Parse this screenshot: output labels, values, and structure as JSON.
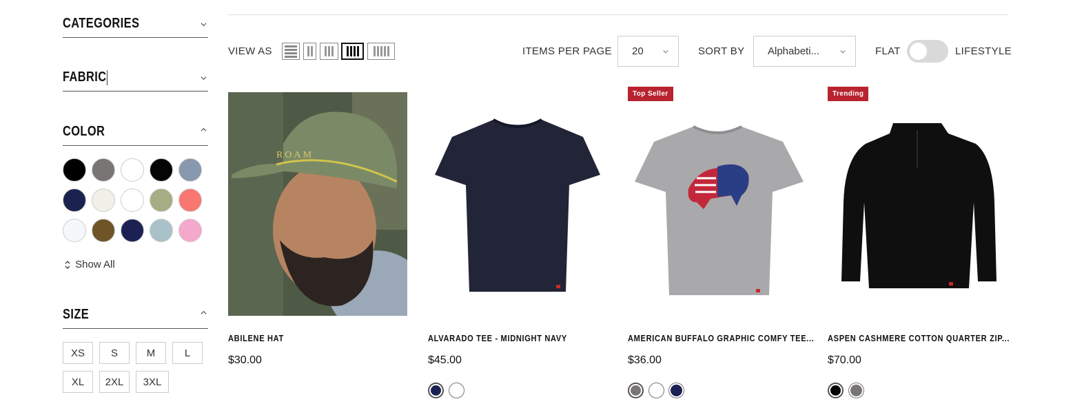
{
  "sidebar": {
    "categories_title": "CATEGORIES",
    "fabric_title": "FABRIC",
    "color_title": "COLOR",
    "size_title": "SIZE",
    "show_all": "Show All",
    "colors": [
      "#000000",
      "#7a7575",
      "#ffffff",
      "#050505",
      "#8898ae",
      "#1a2350",
      "#f3efe9",
      "#ffffff",
      "#a6ad84",
      "#f87770",
      "#f5f8fb",
      "#6f5428",
      "#1b2253",
      "#a9c1c9",
      "#f4a9cc"
    ],
    "sizes": [
      "XS",
      "S",
      "M",
      "L",
      "XL",
      "2XL",
      "3XL"
    ]
  },
  "toolbar": {
    "view_as_label": "VIEW AS",
    "view_options": [
      "list-view-icon",
      "grid-2-icon",
      "grid-3-icon",
      "grid-4-icon",
      "grid-5-icon"
    ],
    "active_view": 3,
    "items_per_page_label": "ITEMS PER PAGE",
    "items_per_page_value": "20",
    "sort_by_label": "SORT BY",
    "sort_by_value": "Alphabeti...",
    "flat_label": "FLAT",
    "lifestyle_label": "LIFESTYLE"
  },
  "products": [
    {
      "name": "ABILENE HAT",
      "price": "$30.00",
      "badge": "",
      "swatches": []
    },
    {
      "name": "ALVARADO TEE - MIDNIGHT NAVY",
      "price": "$45.00",
      "badge": "",
      "swatches": [
        "#1b2253",
        "#ffffff"
      ]
    },
    {
      "name": "AMERICAN BUFFALO GRAPHIC COMFY TEE...",
      "price": "$36.00",
      "badge": "Top Seller",
      "swatches": [
        "#7a7575",
        "#ffffff",
        "#1b2253"
      ]
    },
    {
      "name": "ASPEN CASHMERE COTTON QUARTER ZIP...",
      "price": "$70.00",
      "badge": "Trending",
      "swatches": [
        "#050505",
        "#7a7575"
      ]
    }
  ],
  "colors": {
    "accent_badge": "#b8232f",
    "toggle_track": "#d9d9d9"
  }
}
